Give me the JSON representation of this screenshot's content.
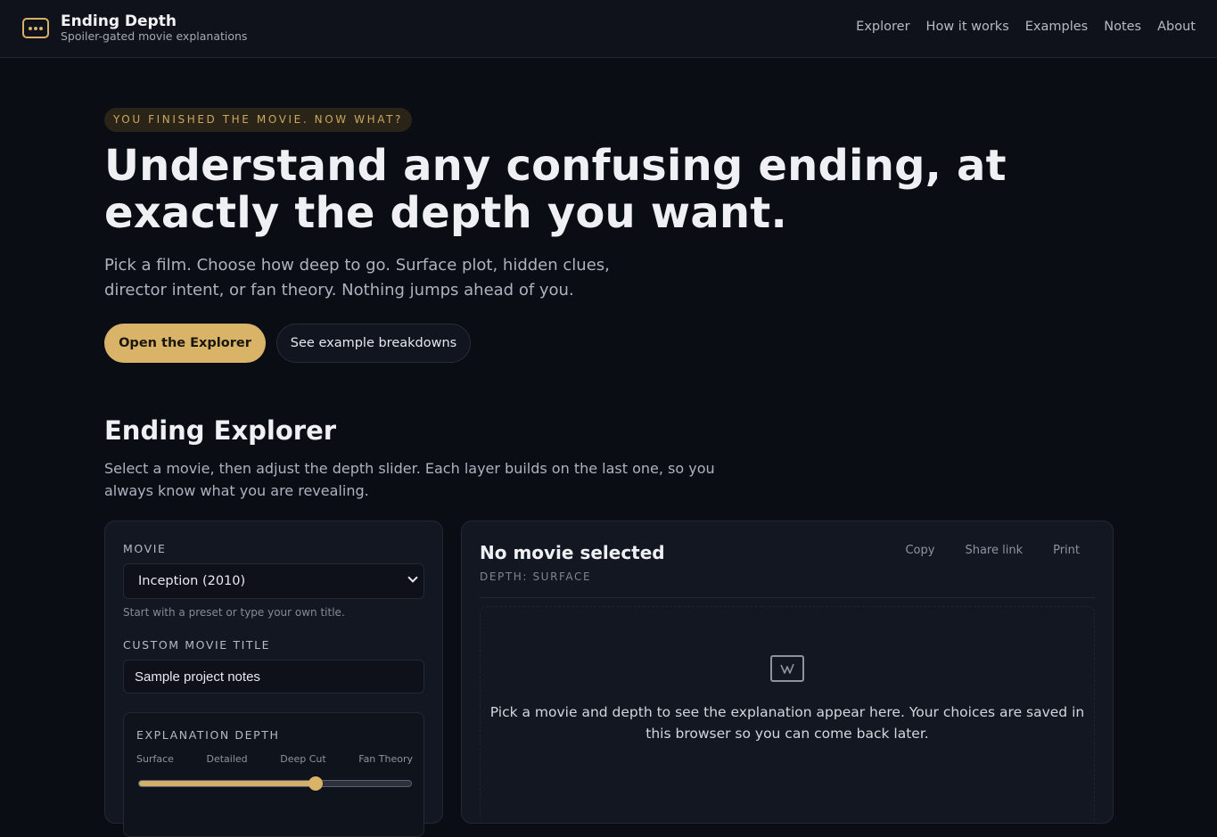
{
  "brand": {
    "title": "Ending Depth",
    "subtitle": "Spoiler-gated movie explanations"
  },
  "nav": {
    "items": [
      "Explorer",
      "How it works",
      "Examples",
      "Notes",
      "About"
    ]
  },
  "hero": {
    "eyebrow": "YOU FINISHED THE MOVIE. NOW WHAT?",
    "title": "Understand any confusing ending, at exactly the depth you want.",
    "subtitle": "Pick a film. Choose how deep to go. Surface plot, hidden clues, director intent, or fan theory. Nothing jumps ahead of you.",
    "primary_cta": "Open the Explorer",
    "secondary_cta": "See example breakdowns"
  },
  "explorer": {
    "title": "Ending Explorer",
    "subtitle": "Select a movie, then adjust the depth slider. Each layer builds on the last one, so you always know what you are revealing.",
    "movie_label": "MOVIE",
    "movie_selected": "Inception (2010)",
    "movie_hint": "Start with a preset or type your own title.",
    "custom_label": "CUSTOM MOVIE TITLE",
    "custom_value": "Sample project notes",
    "depth_label": "EXPLANATION DEPTH",
    "depth_levels": [
      "Surface",
      "Detailed",
      "Deep Cut",
      "Fan Theory"
    ],
    "depth_slider_fraction": 0.65
  },
  "result": {
    "title": "No movie selected",
    "depth_tag": "DEPTH: SURFACE",
    "actions": [
      "Copy",
      "Share link",
      "Print"
    ],
    "empty_message": "Pick a movie and depth to see the explanation appear here. Your choices are saved in this browser so you can come back later."
  },
  "colors": {
    "accent": "#d8b368",
    "background": "#0a0d14",
    "panel": "#131722"
  }
}
